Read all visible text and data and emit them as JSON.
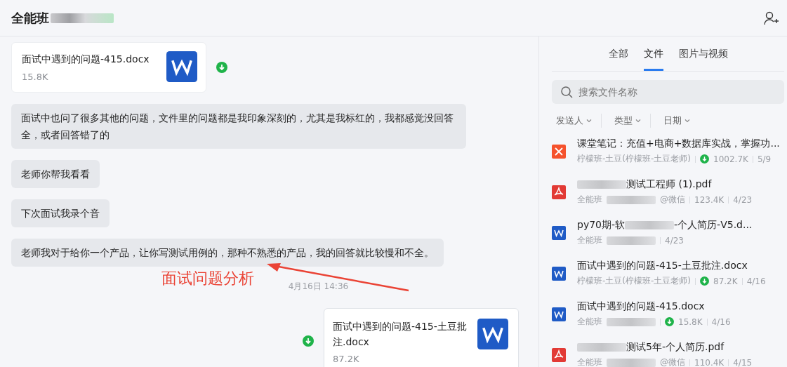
{
  "header": {
    "title": "全能班"
  },
  "messages": [
    {
      "kind": "file",
      "outgoing": false,
      "name": "面试中遇到的问题-415.docx",
      "size": "15.8K",
      "doc": {
        "kind": "word"
      },
      "download_badge": true
    },
    {
      "kind": "text",
      "text": "面试中也问了很多其他的问题，文件里的问题都是我印象深刻的，尤其是我标红的，我都感觉没回答全，或者回答错了的"
    },
    {
      "kind": "text",
      "text": "老师你帮我看看"
    },
    {
      "kind": "text",
      "text": "下次面试我录个音"
    },
    {
      "kind": "text",
      "text": "老师我对于给你一个产品，让你写测试用例的，那种不熟悉的产品，我的回答就比较慢和不全。"
    },
    {
      "kind": "time",
      "text": "4月16日 14:36"
    },
    {
      "kind": "file",
      "outgoing": true,
      "name": "面试中遇到的问题-415-土豆批注.docx",
      "size": "87.2K",
      "doc": {
        "kind": "word"
      },
      "download_badge": true
    }
  ],
  "annotation": {
    "text": "面试问题分析"
  },
  "panel": {
    "tabs": [
      {
        "label": "全部",
        "selected": false
      },
      {
        "label": "文件",
        "selected": true
      },
      {
        "label": "图片与视频",
        "selected": false
      }
    ],
    "search": {
      "placeholder": "搜索文件名称"
    },
    "filters": [
      "发送人",
      "类型",
      "日期"
    ],
    "files": [
      {
        "kind": "xmind",
        "name": [
          {
            "kind": "text",
            "text": "课堂笔记：充值+电商+数据库实战，掌握功..."
          }
        ],
        "sender": [
          {
            "kind": "text",
            "text": "柠檬班-土豆(柠檬班-土豆老师)"
          }
        ],
        "download_badge": true,
        "size": "1002.7K",
        "date": "5/9"
      },
      {
        "kind": "pdf",
        "name": [
          {
            "kind": "blur"
          },
          {
            "kind": "text",
            "text": "测试工程师 (1).pdf"
          }
        ],
        "sender": [
          {
            "kind": "text",
            "text": "全能班"
          },
          {
            "kind": "blur"
          },
          {
            "kind": "text",
            "text": "@微信"
          }
        ],
        "download_badge": false,
        "size": "123.4K",
        "date": "4/23"
      },
      {
        "kind": "word",
        "name": [
          {
            "kind": "text",
            "text": "py70期-软"
          },
          {
            "kind": "blur"
          },
          {
            "kind": "text",
            "text": "-个人简历-V5.d..."
          }
        ],
        "sender": [
          {
            "kind": "text",
            "text": "全能班"
          },
          {
            "kind": "blur"
          }
        ],
        "download_badge": false,
        "date": "4/23"
      },
      {
        "kind": "word",
        "name": [
          {
            "kind": "text",
            "text": "面试中遇到的问题-415-土豆批注.docx"
          }
        ],
        "sender": [
          {
            "kind": "text",
            "text": "柠檬班-土豆(柠檬班-土豆老师)"
          }
        ],
        "download_badge": true,
        "size": "87.2K",
        "date": "4/16"
      },
      {
        "kind": "word",
        "name": [
          {
            "kind": "text",
            "text": "面试中遇到的问题-415.docx"
          }
        ],
        "sender": [
          {
            "kind": "text",
            "text": "全能班"
          },
          {
            "kind": "blur"
          }
        ],
        "download_badge": true,
        "size": "15.8K",
        "date": "4/16"
      },
      {
        "kind": "pdf",
        "name": [
          {
            "kind": "blur"
          },
          {
            "kind": "text",
            "text": "测试5年-个人简历.pdf"
          }
        ],
        "sender": [
          {
            "kind": "text",
            "text": "全能班"
          },
          {
            "kind": "blur"
          },
          {
            "kind": "text",
            "text": "@微信"
          }
        ],
        "download_badge": false,
        "size": "110.4K",
        "date": "4/15"
      }
    ]
  }
}
